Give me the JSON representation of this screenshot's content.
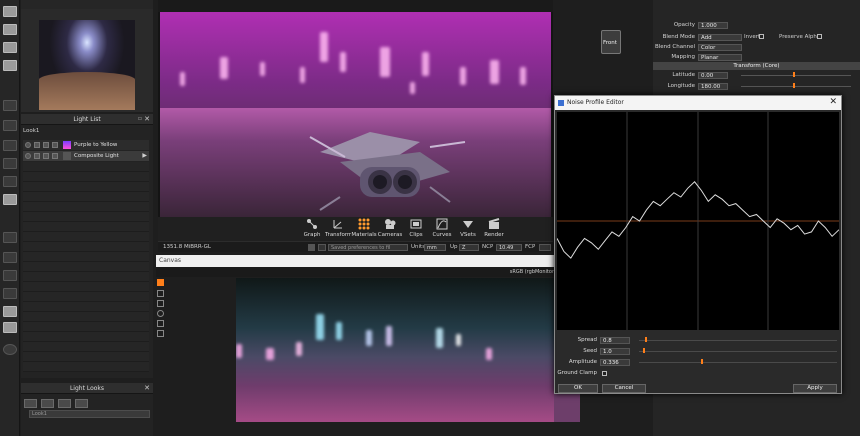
{
  "colors": {
    "accent": "#ff7f1a",
    "selection": "#3b3b3b",
    "light_gradient_start": "#7a3cff",
    "light_gradient_end": "#ff4fd8"
  },
  "light_list": {
    "title": "Light List",
    "look_name": "Look1",
    "items": [
      {
        "label": "Purple to Yellow",
        "icon": "gradient-swatch-icon"
      },
      {
        "label": "Composite Light",
        "icon": "composite-light-icon"
      }
    ]
  },
  "light_looks": {
    "title": "Light Looks",
    "field_value": "Look1"
  },
  "viewport": {
    "top_label": "Front",
    "toolbar": [
      {
        "label": "Graph",
        "icon": "graph-icon"
      },
      {
        "label": "Transform",
        "icon": "transform-icon"
      },
      {
        "label": "Materials",
        "icon": "materials-icon"
      },
      {
        "label": "Cameras",
        "icon": "cameras-icon"
      },
      {
        "label": "Clips",
        "icon": "clips-icon"
      },
      {
        "label": "Curves",
        "icon": "curves-icon"
      },
      {
        "label": "VSets",
        "icon": "vsets-icon"
      },
      {
        "label": "Render",
        "icon": "render-icon"
      }
    ],
    "status": {
      "memory": "1351.8 MiB",
      "renderer": "RR-GL",
      "message": "Saved preferences to fil",
      "units_label": "Units",
      "units_value": "mm",
      "up_label": "Up",
      "up_value": "Z",
      "ncp_label": "NCP",
      "ncp_value": "10.49",
      "fcp_label": "FCP"
    }
  },
  "canvas": {
    "title": "Canvas",
    "colorspace": "sRGB (rgbMonitor"
  },
  "properties": {
    "opacity_label": "Opacity",
    "opacity_value": "1.000",
    "blend_mode_label": "Blend Mode",
    "blend_mode_value": "Add",
    "invert_label": "Invert",
    "preserve_alpha_label": "Preserve Alpha",
    "blend_channel_label": "Blend Channel",
    "blend_channel_value": "Color",
    "mapping_label": "Mapping",
    "mapping_value": "Planar",
    "section_title": "Transform (Core)",
    "latitude_label": "Latitude",
    "latitude_value": "0.00",
    "longitude_label": "Longitude",
    "longitude_value": "180.00"
  },
  "noise_dialog": {
    "title": "Noise Profile Editor",
    "spread_label": "Spread",
    "spread_value": "0.8",
    "seed_label": "Seed",
    "seed_value": "1.0",
    "amplitude_label": "Amplitude",
    "amplitude_value": "0.336",
    "ground_clamp_label": "Ground Clamp",
    "ok_label": "OK",
    "cancel_label": "Cancel",
    "apply_label": "Apply",
    "curve": [
      0.42,
      0.36,
      0.33,
      0.38,
      0.42,
      0.4,
      0.37,
      0.41,
      0.45,
      0.43,
      0.47,
      0.52,
      0.5,
      0.55,
      0.59,
      0.57,
      0.6,
      0.63,
      0.61,
      0.65,
      0.68,
      0.64,
      0.59,
      0.62,
      0.6,
      0.57,
      0.58,
      0.55,
      0.52,
      0.53,
      0.5,
      0.47,
      0.51,
      0.49,
      0.46,
      0.48,
      0.44,
      0.45,
      0.5,
      0.47,
      0.43,
      0.46
    ]
  }
}
